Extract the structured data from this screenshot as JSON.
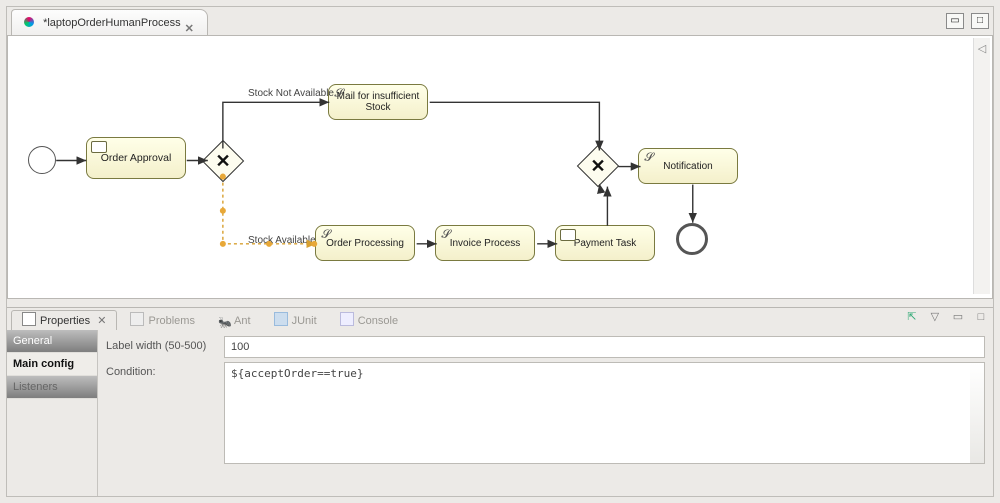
{
  "editor": {
    "tab_title": "*laptopOrderHumanProcess",
    "tab_close_glyph": "✕"
  },
  "diagram": {
    "tasks": {
      "order_approval": "Order Approval",
      "mail_insufficient": "Mail for insufficient Stock",
      "order_processing": "Order Processing",
      "invoice_process": "Invoice Process",
      "payment_task": "Payment Task",
      "notification": "Notification"
    },
    "labels": {
      "stock_not_available": "Stock Not Available",
      "stock_available": "Stock Available"
    }
  },
  "views": {
    "properties": "Properties",
    "problems": "Problems",
    "ant": "Ant",
    "junit": "JUnit",
    "console": "Console"
  },
  "properties": {
    "side": {
      "general": "General",
      "main_config": "Main config",
      "listeners": "Listeners"
    },
    "label_width_caption": "Label width (50-500)",
    "label_width_value": "100",
    "condition_caption": "Condition:",
    "condition_value": "${acceptOrder==true}"
  }
}
